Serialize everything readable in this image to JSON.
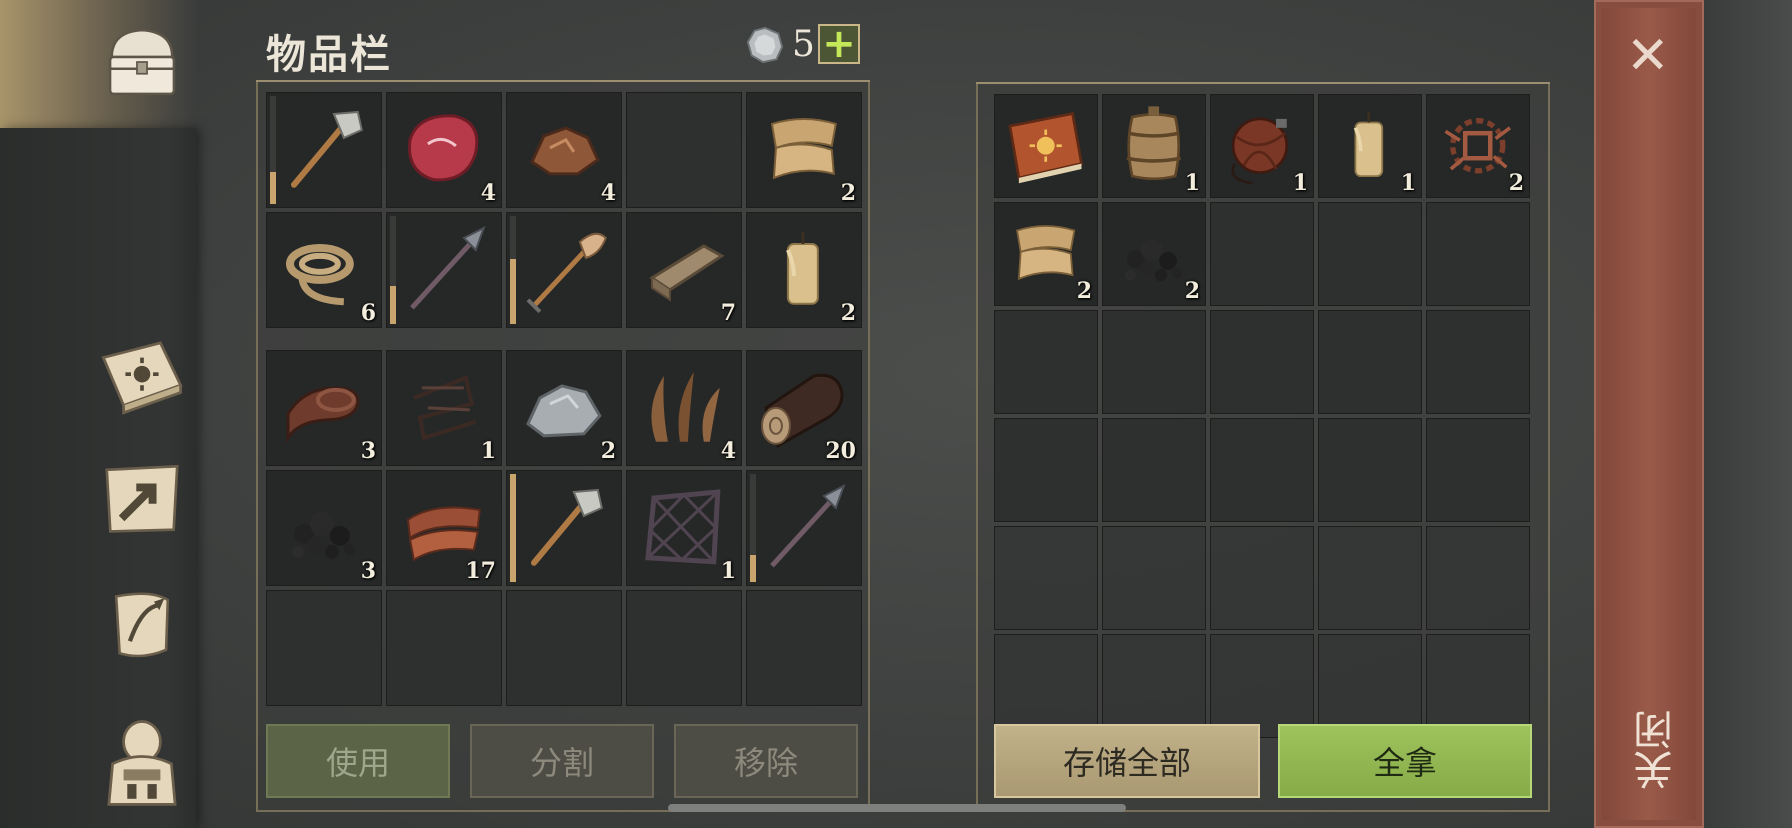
{
  "title": "物品栏",
  "currency": {
    "icon": "silver-coin-icon",
    "count": "5",
    "add_label": "+"
  },
  "inventory_top": [
    {
      "icon": "stone-hammer-icon",
      "qty": "",
      "durability": 0.3
    },
    {
      "icon": "raw-meat-icon",
      "qty": "4"
    },
    {
      "icon": "copper-ore-icon",
      "qty": "4"
    },
    {
      "icon": "",
      "qty": ""
    },
    {
      "icon": "cloth-icon",
      "qty": "2"
    },
    {
      "icon": "rope-icon",
      "qty": "6"
    },
    {
      "icon": "spear-icon",
      "qty": "",
      "durability": 0.35
    },
    {
      "icon": "shovel-icon",
      "qty": "",
      "durability": 0.6
    },
    {
      "icon": "wood-plank-icon",
      "qty": "7"
    },
    {
      "icon": "candle-icon",
      "qty": "2"
    }
  ],
  "inventory_bottom": [
    {
      "icon": "leather-roll-icon",
      "qty": "3"
    },
    {
      "icon": "wire-coil-icon",
      "qty": "1"
    },
    {
      "icon": "iron-ore-icon",
      "qty": "2"
    },
    {
      "icon": "fiber-icon",
      "qty": "4"
    },
    {
      "icon": "log-icon",
      "qty": "20"
    },
    {
      "icon": "coal-icon",
      "qty": "3"
    },
    {
      "icon": "bacon-icon",
      "qty": "17"
    },
    {
      "icon": "stone-hammer-icon",
      "qty": "",
      "durability": 1.0
    },
    {
      "icon": "lattice-frame-icon",
      "qty": "1"
    },
    {
      "icon": "spear-icon",
      "qty": "",
      "durability": 0.25
    },
    {
      "icon": "",
      "qty": ""
    },
    {
      "icon": "",
      "qty": ""
    },
    {
      "icon": "",
      "qty": ""
    },
    {
      "icon": "",
      "qty": ""
    },
    {
      "icon": "",
      "qty": ""
    }
  ],
  "storage": [
    {
      "icon": "recipe-book-icon",
      "qty": ""
    },
    {
      "icon": "barrel-icon",
      "qty": "1"
    },
    {
      "icon": "leather-flask-icon",
      "qty": "1"
    },
    {
      "icon": "candle-icon",
      "qty": "1"
    },
    {
      "icon": "scrap-metal-icon",
      "qty": "2"
    },
    {
      "icon": "cloth-icon",
      "qty": "2"
    },
    {
      "icon": "coal-icon",
      "qty": "2"
    }
  ],
  "buttons": {
    "use": "使用",
    "split": "分割",
    "remove": "移除",
    "store_all": "存储全部",
    "take_all": "全拿"
  },
  "close": {
    "icon": "close-icon",
    "label": "关闭"
  },
  "nav": [
    {
      "icon": "chest-icon",
      "active": true
    },
    {
      "icon": "recipe-book-icon",
      "active": false
    },
    {
      "icon": "crafting-map-icon",
      "active": false
    },
    {
      "icon": "quest-scroll-icon",
      "active": false
    },
    {
      "icon": "character-backpack-icon",
      "active": false
    }
  ],
  "colors": {
    "accent_green": "#9ec35d",
    "panel_border": "#776e58",
    "close_red": "#8e4f40",
    "gold": "#c9a46c"
  }
}
